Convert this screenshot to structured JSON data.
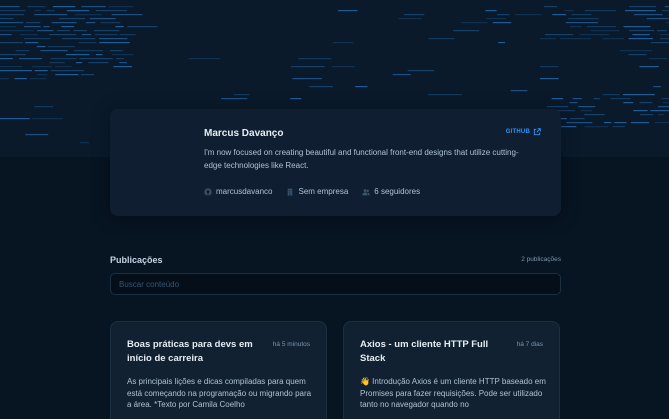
{
  "profile": {
    "name": "Marcus Davanço",
    "github_label": "GITHUB",
    "bio": "I'm now focused on creating beautiful and functional front-end designs that utilize cutting-edge technologies like React.",
    "username": "marcusdavanco",
    "company": "Sem empresa",
    "followers": "6 seguidores"
  },
  "publications": {
    "title": "Publicações",
    "count": "2 publicações",
    "search_placeholder": "Buscar conteúdo"
  },
  "posts": [
    {
      "title": "Boas práticas para devs em início de carreira",
      "time": "há 5 minutos",
      "body": "As principais lições e dicas compiladas para quem está começando na programação ou migrando para a área. *Texto por Camila Coelho"
    },
    {
      "title": "Axios - um cliente HTTP Full Stack",
      "time": "há 7 dias",
      "body": "👋 Introdução Axios é um cliente HTTP baseado em Promises para fazer requisições. Pode ser utilizado tanto no navegador quando no"
    }
  ],
  "colors": {
    "background": "#071422",
    "card": "#0f1e31",
    "accent": "#3294f8",
    "title": "#e7edf4"
  },
  "icons": {
    "github": "github-icon",
    "external": "external-link-icon",
    "building": "building-icon",
    "users": "users-icon"
  }
}
